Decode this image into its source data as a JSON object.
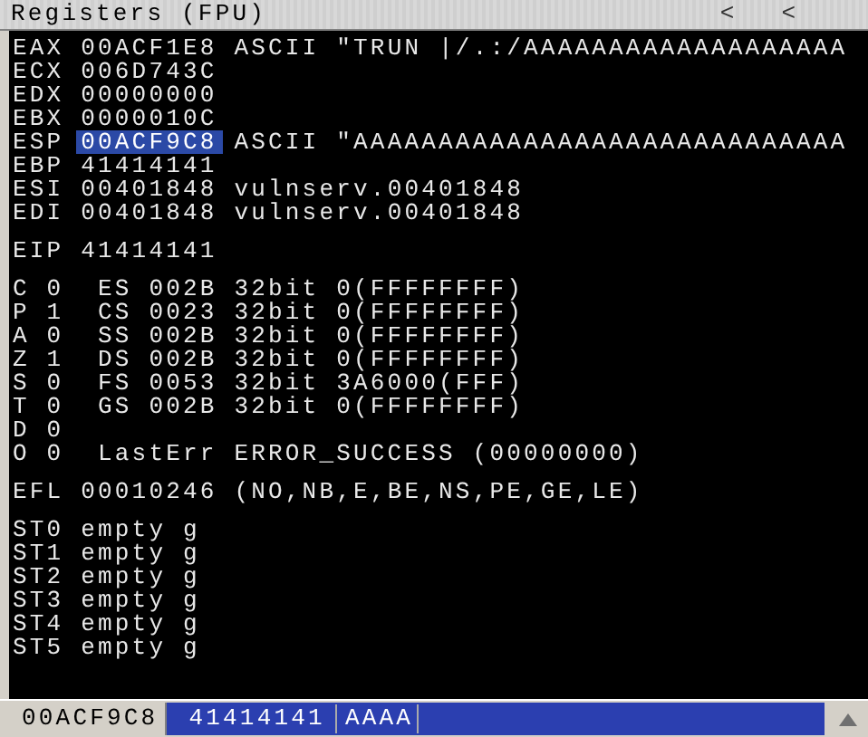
{
  "title": "Registers (FPU)",
  "title_buttons": [
    "<",
    "<"
  ],
  "registers": [
    {
      "name": "EAX",
      "value": "00ACF1E8",
      "comment": "ASCII \"TRUN |/.:/AAAAAAAAAAAAAAAAAAA",
      "selected": false
    },
    {
      "name": "ECX",
      "value": "006D743C",
      "selected": false
    },
    {
      "name": "EDX",
      "value": "00000000",
      "selected": false
    },
    {
      "name": "EBX",
      "value": "0000010C",
      "selected": false
    },
    {
      "name": "ESP",
      "value": "00ACF9C8",
      "comment": "ASCII \"AAAAAAAAAAAAAAAAAAAAAAAAAAAAA",
      "selected": true
    },
    {
      "name": "EBP",
      "value": "41414141",
      "selected": false
    },
    {
      "name": "ESI",
      "value": "00401848",
      "comment": "vulnserv.00401848",
      "selected": false
    },
    {
      "name": "EDI",
      "value": "00401848",
      "comment": "vulnserv.00401848",
      "selected": false
    }
  ],
  "eip": {
    "name": "EIP",
    "value": "41414141"
  },
  "flags": [
    {
      "flag": "C",
      "bit": "0",
      "segment": "ES 002B 32bit 0(FFFFFFFF)"
    },
    {
      "flag": "P",
      "bit": "1",
      "segment": "CS 0023 32bit 0(FFFFFFFF)"
    },
    {
      "flag": "A",
      "bit": "0",
      "segment": "SS 002B 32bit 0(FFFFFFFF)"
    },
    {
      "flag": "Z",
      "bit": "1",
      "segment": "DS 002B 32bit 0(FFFFFFFF)"
    },
    {
      "flag": "S",
      "bit": "0",
      "segment": "FS 0053 32bit 3A6000(FFF)"
    },
    {
      "flag": "T",
      "bit": "0",
      "segment": "GS 002B 32bit 0(FFFFFFFF)"
    },
    {
      "flag": "D",
      "bit": "0"
    },
    {
      "flag": "O",
      "bit": "0",
      "segment": "LastErr ERROR_SUCCESS (00000000)"
    }
  ],
  "efl": {
    "name": "EFL",
    "value": "00010246",
    "comment": "(NO,NB,E,BE,NS,PE,GE,LE)"
  },
  "fpu": [
    {
      "name": "ST0",
      "state": "empty",
      "tag": "g"
    },
    {
      "name": "ST1",
      "state": "empty",
      "tag": "g"
    },
    {
      "name": "ST2",
      "state": "empty",
      "tag": "g"
    },
    {
      "name": "ST3",
      "state": "empty",
      "tag": "g"
    },
    {
      "name": "ST4",
      "state": "empty",
      "tag": "g"
    },
    {
      "name": "ST5",
      "state": "empty",
      "tag": "g"
    }
  ],
  "status_bar": {
    "address": "00ACF9C8",
    "value": "41414141",
    "ascii": "AAAA"
  }
}
